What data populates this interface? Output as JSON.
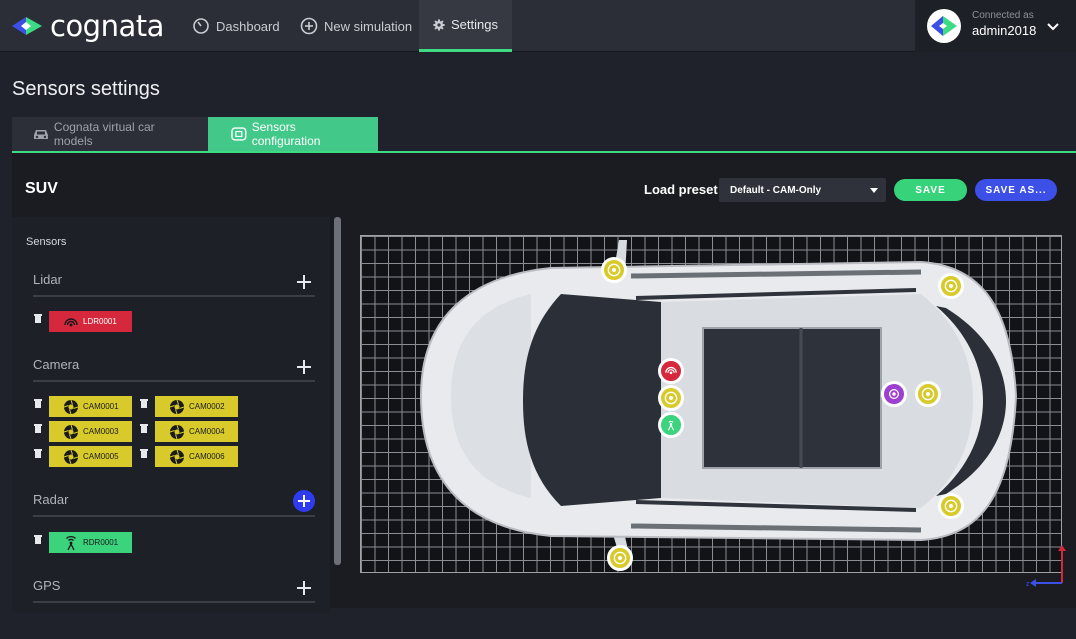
{
  "header": {
    "logo_text": "cognata",
    "nav": [
      {
        "label": "Dashboard",
        "icon": "dashboard-icon"
      },
      {
        "label": "New simulation",
        "icon": "plus-circle-icon"
      },
      {
        "label": "Settings",
        "icon": "gear-icon",
        "active": true
      }
    ],
    "user": {
      "caption": "Connected as",
      "name": "admin2018"
    }
  },
  "page": {
    "title": "Sensors settings",
    "tabs": [
      {
        "label": "Cognata virtual car models",
        "icon": "car-icon",
        "active": false
      },
      {
        "label": "Sensors configuration",
        "icon": "sensor-frame-icon",
        "active": true
      }
    ]
  },
  "toolbar": {
    "vehicle": "SUV",
    "preset_label": "Load preset",
    "preset_value": "Default - CAM-Only",
    "save_label": "SAVE",
    "save_as_label": "SAVE AS..."
  },
  "sensors": {
    "title": "Sensors",
    "groups": [
      {
        "name": "Lidar",
        "items": [
          {
            "label": "LDR0001",
            "icon": "lidar-icon"
          }
        ]
      },
      {
        "name": "Camera",
        "items": [
          {
            "label": "CAM0001",
            "icon": "camera-aperture-icon"
          },
          {
            "label": "CAM0002",
            "icon": "camera-aperture-icon"
          },
          {
            "label": "CAM0003",
            "icon": "camera-aperture-icon"
          },
          {
            "label": "CAM0004",
            "icon": "camera-aperture-icon"
          },
          {
            "label": "CAM0005",
            "icon": "camera-aperture-icon"
          },
          {
            "label": "CAM0006",
            "icon": "camera-aperture-icon"
          }
        ]
      },
      {
        "name": "Radar",
        "items": [
          {
            "label": "RDR0001",
            "icon": "radar-icon"
          }
        ]
      },
      {
        "name": "GPS",
        "items": []
      }
    ]
  },
  "colors": {
    "accent_green": "#3ddc84",
    "save_blue": "#3c4fe6",
    "lidar_red": "#d6283c",
    "camera_yellow": "#d9ca2b",
    "radar_green": "#3bd37c",
    "gps_purple": "#9d3fd0"
  }
}
